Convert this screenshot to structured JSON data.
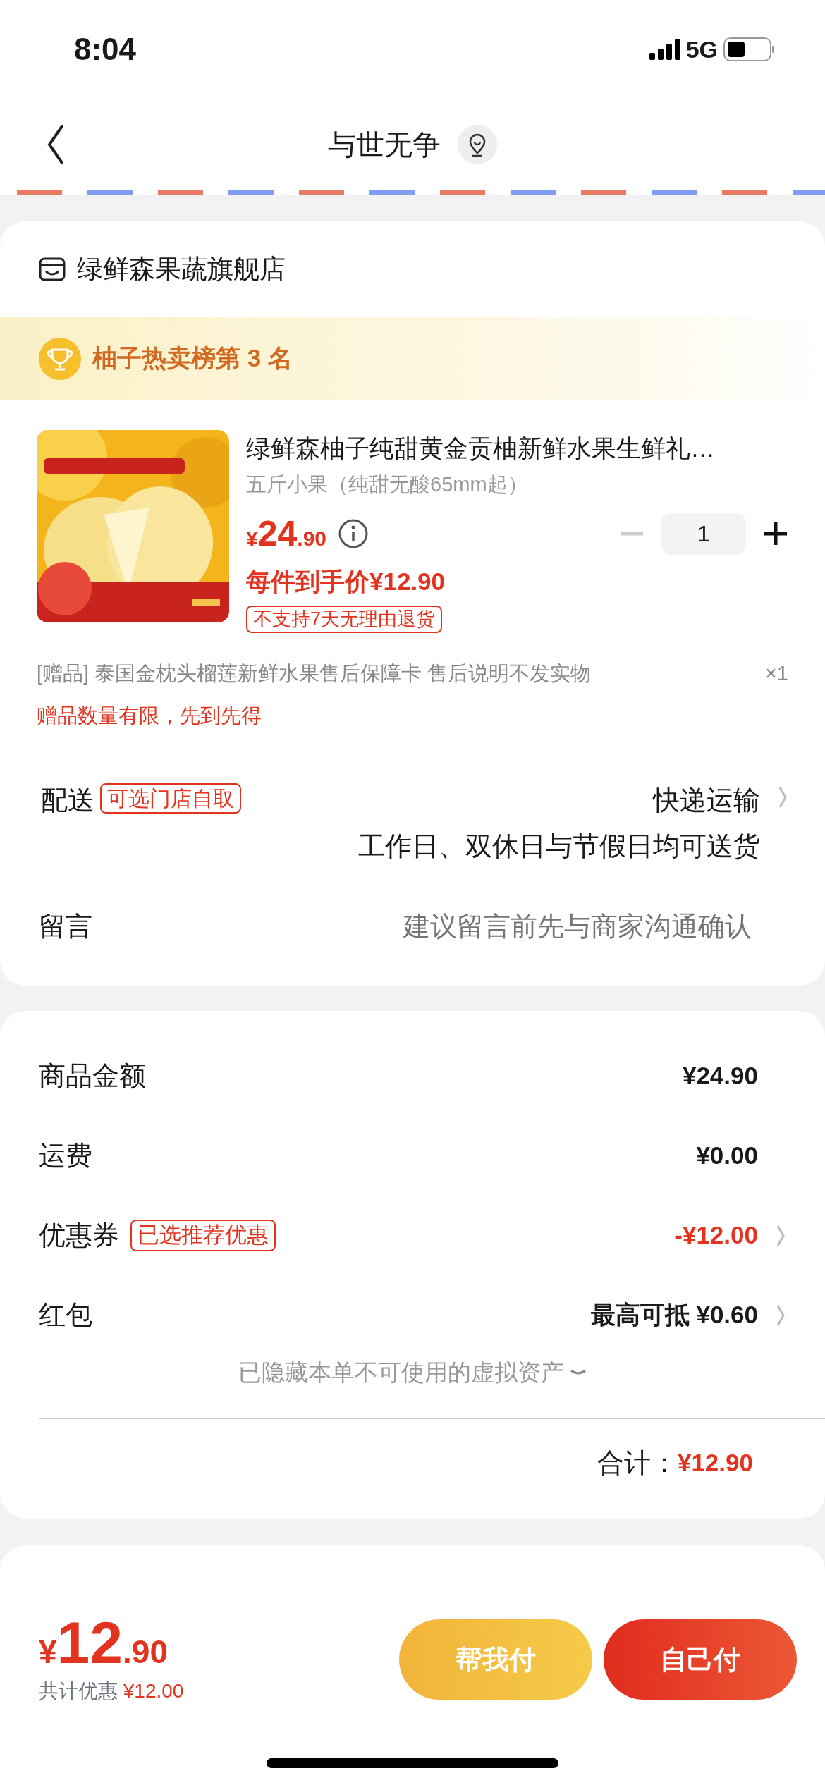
{
  "status_bar": {
    "time": "8:04",
    "network": "5G"
  },
  "nav": {
    "title": "与世无争"
  },
  "store": {
    "name": "绿鲜森果蔬旗舰店"
  },
  "rank_banner": {
    "text": "柚子热卖榜第 3 名"
  },
  "product": {
    "title": "绿鲜森柚子纯甜黄金贡柚新鲜水果生鲜礼…",
    "spec": "五斤小果（纯甜无酸65mm起）",
    "currency": "¥",
    "price_int": "24",
    "price_dec": ".90",
    "each_price": "每件到手价¥12.90",
    "quantity": "1",
    "minus_disabled": true,
    "tag": "不支持7天无理由退货"
  },
  "gift": {
    "label": "[赠品]",
    "name": "泰国金枕头榴莲新鲜水果售后保障卡 售后说明不发实物",
    "qty": "×1",
    "note": "赠品数量有限，先到先得"
  },
  "delivery": {
    "label": "配送",
    "tag": "可选门店自取",
    "method": "快递运输",
    "note": "工作日、双休日与节假日均可送货"
  },
  "message": {
    "label": "留言",
    "placeholder": "建议留言前先与商家沟通确认"
  },
  "summary": {
    "rows": [
      {
        "label": "商品金额",
        "value": "¥24.90",
        "kind": "plain",
        "chevron": false
      },
      {
        "label": "运费",
        "value": "¥0.00",
        "kind": "plain",
        "chevron": false
      },
      {
        "label": "优惠券",
        "tag": "已选推荐优惠",
        "value": "-¥12.00",
        "kind": "discount",
        "chevron": true
      },
      {
        "label": "红包",
        "value": "最高可抵 ¥0.60",
        "kind": "plain",
        "chevron": true
      }
    ],
    "hidden_note": "已隐藏本单不可使用的虚拟资产",
    "total_label": "合计：",
    "total": "¥12.90"
  },
  "bottom_bar": {
    "currency": "¥",
    "total_int": "12",
    "total_dec": ".90",
    "saved_label": "共计优惠",
    "saved": "¥12.00",
    "buttons": [
      {
        "label": "帮我付",
        "kind": "secondary"
      },
      {
        "label": "自己付",
        "kind": "primary"
      }
    ]
  }
}
